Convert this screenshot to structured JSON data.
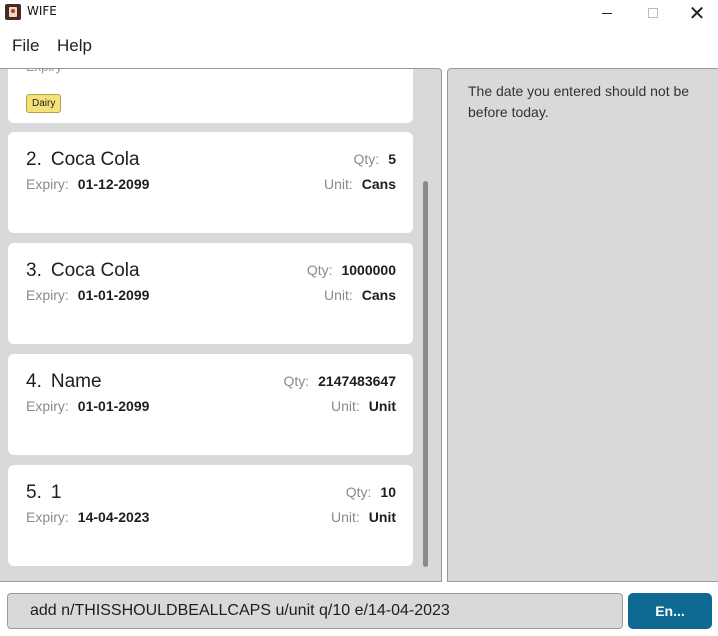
{
  "window": {
    "title": "WIFE",
    "controls": [
      "minimize-icon",
      "maximize-icon",
      "close-icon"
    ]
  },
  "menu": {
    "file": "File",
    "help": "Help"
  },
  "list": {
    "partial_tag": "Dairy",
    "items": [
      {
        "index": "2.",
        "name": "Coca Cola",
        "qty_label": "Qty:",
        "qty": "5",
        "expiry_label": "Expiry:",
        "expiry": "01-12-2099",
        "unit_label": "Unit:",
        "unit": "Cans"
      },
      {
        "index": "3.",
        "name": "Coca Cola",
        "qty_label": "Qty:",
        "qty": "1000000",
        "expiry_label": "Expiry:",
        "expiry": "01-01-2099",
        "unit_label": "Unit:",
        "unit": "Cans"
      },
      {
        "index": "4.",
        "name": "Name",
        "qty_label": "Qty:",
        "qty": "2147483647",
        "expiry_label": "Expiry:",
        "expiry": "01-01-2099",
        "unit_label": "Unit:",
        "unit": "Unit"
      },
      {
        "index": "5.",
        "name": "1",
        "qty_label": "Qty:",
        "qty": "10",
        "expiry_label": "Expiry:",
        "expiry": "14-04-2023",
        "unit_label": "Unit:",
        "unit": "Unit"
      }
    ]
  },
  "result": {
    "message": "The date you entered should not be before today."
  },
  "command": {
    "value": "add n/THISSHOULDBEALLCAPS u/unit q/10 e/14-04-2023",
    "button_label": "En..."
  },
  "colors": {
    "accent": "#0e6a93",
    "tag": "#f5e07a",
    "panel": "#d9d9d9"
  }
}
